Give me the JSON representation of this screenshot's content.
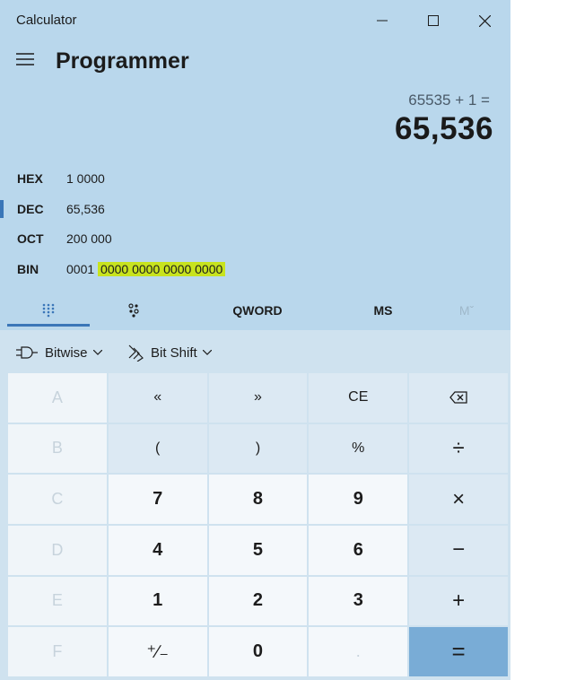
{
  "window": {
    "title": "Calculator"
  },
  "header": {
    "mode": "Programmer"
  },
  "display": {
    "expression": "65535 + 1 =",
    "result": "65,536"
  },
  "radix": [
    {
      "name": "HEX",
      "value": "1 0000"
    },
    {
      "name": "DEC",
      "value": "65,536",
      "active": true
    },
    {
      "name": "OCT",
      "value": "200 000"
    },
    {
      "name": "BIN",
      "value_plain": "0001",
      "value_highlighted": "0000 0000 0000 0000"
    }
  ],
  "tabs": {
    "word_size": "QWORD",
    "ms": "MS",
    "m": "Mˇ"
  },
  "ops": {
    "bitwise": "Bitwise",
    "bitshift": "Bit Shift"
  },
  "keys": {
    "row1": [
      "A",
      "«",
      "»",
      "CE",
      "backspace"
    ],
    "row2": [
      "B",
      "(",
      ")",
      "%",
      "÷"
    ],
    "row3": [
      "C",
      "7",
      "8",
      "9",
      "×"
    ],
    "row4": [
      "D",
      "4",
      "5",
      "6",
      "−"
    ],
    "row5": [
      "E",
      "1",
      "2",
      "3",
      "+"
    ],
    "row6": [
      "F",
      "⁺∕₋",
      "0",
      ".",
      "="
    ]
  },
  "colors": {
    "accent": "#3a76b8",
    "highlight": "#c8e31e",
    "equals": "#79acd6"
  }
}
